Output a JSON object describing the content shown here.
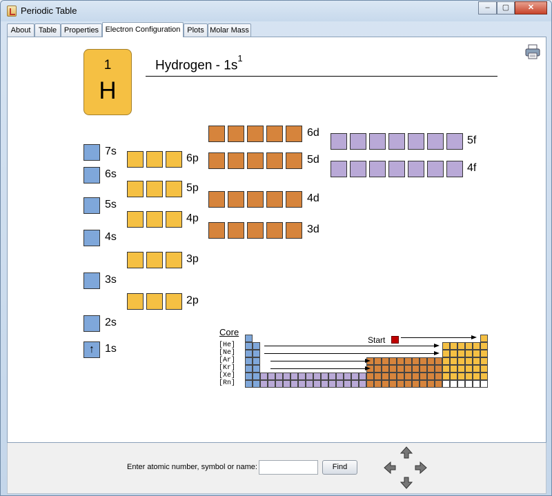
{
  "window": {
    "title": "Periodic Table",
    "minimize": "–",
    "maximize": "▢",
    "close": "✕"
  },
  "tabs": [
    {
      "label": "About"
    },
    {
      "label": "Table"
    },
    {
      "label": "Properties"
    },
    {
      "label": "Electron Configuration"
    },
    {
      "label": "Plots"
    },
    {
      "label": "Molar Mass"
    }
  ],
  "element": {
    "number": "1",
    "symbol": "H",
    "name_config": "Hydrogen - 1s",
    "superscript": "1"
  },
  "orbitals": {
    "s": [
      "7s",
      "6s",
      "5s",
      "4s",
      "3s",
      "2s",
      "1s"
    ],
    "p": [
      "6p",
      "5p",
      "4p",
      "3p",
      "2p"
    ],
    "d": [
      "6d",
      "5d",
      "4d",
      "3d"
    ],
    "f": [
      "5f",
      "4f"
    ],
    "electron_arrow": "↑"
  },
  "core": {
    "title": "Core",
    "start_label": "Start",
    "labels": [
      "[He]",
      "[Ne]",
      "[Ar]",
      "[Kr]",
      "[Xe]",
      "[Rn]"
    ]
  },
  "finder": {
    "label": "Enter atomic number, symbol or name:",
    "value": "",
    "button": "Find"
  },
  "colors": {
    "s": "#7fa7da",
    "p": "#f5c043",
    "d": "#d6843c",
    "f": "#b9a9d7",
    "start": "#c00000"
  }
}
